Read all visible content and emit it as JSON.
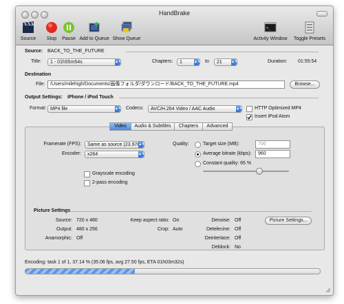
{
  "window": {
    "title": "HandBrake"
  },
  "toolbar": {
    "source": "Source",
    "stop": "Stop",
    "pause": "Pause",
    "add_to_queue": "Add to Queue",
    "show_queue": "Show Queue",
    "activity_window": "Activity Window",
    "toggle_presets": "Toggle Presets"
  },
  "source": {
    "label": "Source:",
    "name": "BACK_TO_THE_FUTURE",
    "title_label": "Title:",
    "title_value": "1 - 01h55m54s",
    "chapters_label": "Chapters:",
    "chapter_from": "1",
    "to_label": "to",
    "chapter_to": "21",
    "duration_label": "Duration:",
    "duration_value": "01:55:54"
  },
  "destination": {
    "heading": "Destination",
    "file_label": "File:",
    "file_path": "/Users/milehigh/Documents/画像フォルダ/ダウンロード/BACK_TO_THE_FUTURE.mp4",
    "browse": "Browse..."
  },
  "output": {
    "heading": "Output Settings:",
    "preset": "iPhone / iPod Touch",
    "format_label": "Format:",
    "format_value": "MP4 file",
    "codecs_label": "Codecs:",
    "codecs_value": "AVC/H.264 Video / AAC Audio",
    "http_optimized": "HTTP Optimized MP4",
    "http_checked": false,
    "ipod_atom": "Insert iPod Atom",
    "ipod_checked": true
  },
  "tabs": [
    "Video",
    "Audio & Subtitles",
    "Chapters",
    "Advanced"
  ],
  "active_tab": "Video",
  "video": {
    "framerate_label": "Framerate (FPS):",
    "framerate_value": "Same as source (23.976)",
    "encoder_label": "Encoder:",
    "encoder_value": "x264",
    "grayscale": "Grayscale encoding",
    "grayscale_checked": false,
    "twopass": "2-pass encoding",
    "twopass_checked": false,
    "quality_label": "Quality:",
    "target_size": "Target size (MB):",
    "target_size_value": "700",
    "avg_bitrate": "Average bitrate (kbps):",
    "avg_bitrate_value": "960",
    "constant_quality": "Constant quality: 65 %",
    "selected_quality_mode": "avg_bitrate",
    "quality_slider_fraction": 0.65
  },
  "picture": {
    "heading": "Picture Settings",
    "source_label": "Source:",
    "source_value": "720 x 480",
    "output_label": "Output:",
    "output_value": "480 x 256",
    "anamorphic_label": "Anamorphic:",
    "anamorphic_value": "Off",
    "keep_aspect_label": "Keep aspect ratio:",
    "keep_aspect_value": "On",
    "crop_label": "Crop:",
    "crop_value": "Auto",
    "denoise_label": "Denoise:",
    "denoise_value": "Off",
    "detelecine_label": "Detelecine:",
    "detelecine_value": "Off",
    "deinterlace_label": "Deinterlace:",
    "deinterlace_value": "Off",
    "deblock_label": "Deblock:",
    "deblock_value": "No",
    "settings_button": "Picture Settings..."
  },
  "status": {
    "text": "Encoding: task 1 of 1, 37.14 % (35.06 fps, avg 27.50 fps, ETA 01h03m32s)",
    "progress_fraction": 0.3714
  }
}
